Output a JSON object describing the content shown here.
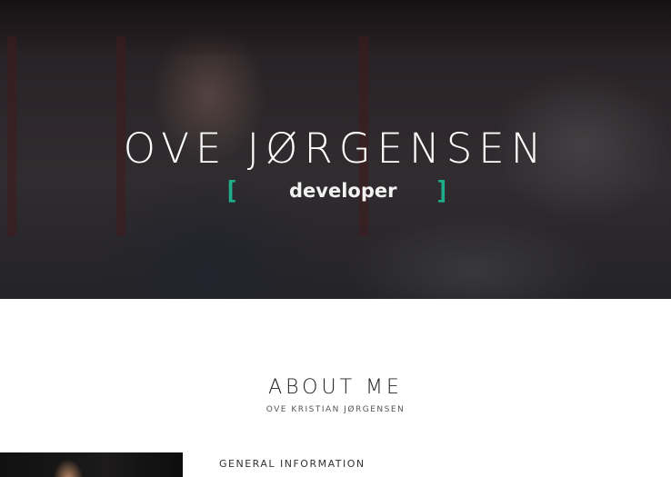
{
  "hero": {
    "name": "OVE JØRGENSEN",
    "bracket_open": "[",
    "role": "developer",
    "bracket_close": "]",
    "accent_color": "#1fae8c"
  },
  "about": {
    "title": "ABOUT ME",
    "subtitle": "OVE KRISTIAN JØRGENSEN",
    "section_heading": "GENERAL INFORMATION"
  }
}
